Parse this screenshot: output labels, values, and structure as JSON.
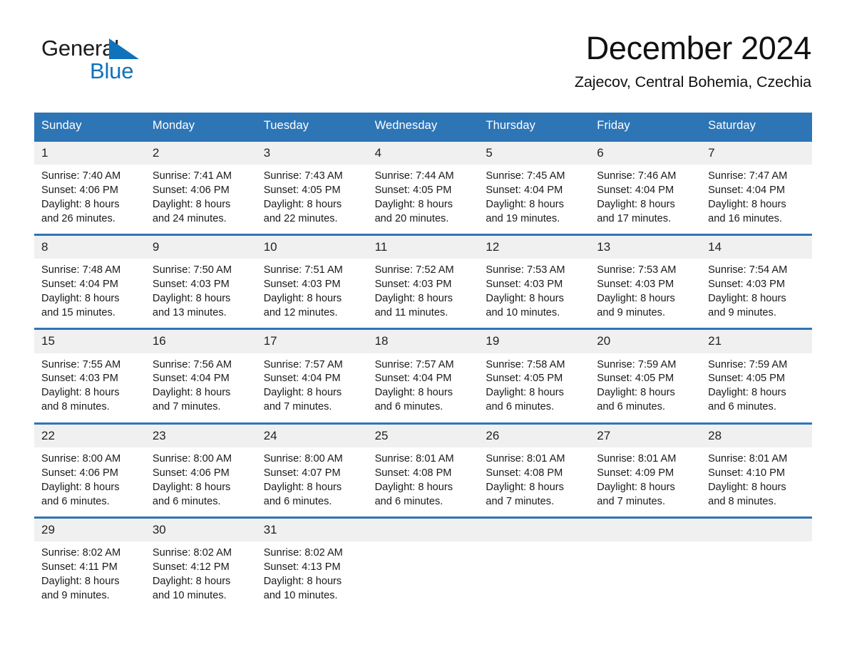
{
  "brand": {
    "name_part1": "General",
    "name_part2": "Blue",
    "accent_color": "#1072bb"
  },
  "header": {
    "title": "December 2024",
    "subtitle": "Zajecov, Central Bohemia, Czechia"
  },
  "theme": {
    "header_blue": "#2e75b6",
    "daynum_band": "#f0f0f0",
    "text": "#1a1a1a"
  },
  "weekdays": [
    "Sunday",
    "Monday",
    "Tuesday",
    "Wednesday",
    "Thursday",
    "Friday",
    "Saturday"
  ],
  "weeks": [
    {
      "days": [
        {
          "num": "1",
          "sunrise": "Sunrise: 7:40 AM",
          "sunset": "Sunset: 4:06 PM",
          "daylight1": "Daylight: 8 hours",
          "daylight2": "and 26 minutes."
        },
        {
          "num": "2",
          "sunrise": "Sunrise: 7:41 AM",
          "sunset": "Sunset: 4:06 PM",
          "daylight1": "Daylight: 8 hours",
          "daylight2": "and 24 minutes."
        },
        {
          "num": "3",
          "sunrise": "Sunrise: 7:43 AM",
          "sunset": "Sunset: 4:05 PM",
          "daylight1": "Daylight: 8 hours",
          "daylight2": "and 22 minutes."
        },
        {
          "num": "4",
          "sunrise": "Sunrise: 7:44 AM",
          "sunset": "Sunset: 4:05 PM",
          "daylight1": "Daylight: 8 hours",
          "daylight2": "and 20 minutes."
        },
        {
          "num": "5",
          "sunrise": "Sunrise: 7:45 AM",
          "sunset": "Sunset: 4:04 PM",
          "daylight1": "Daylight: 8 hours",
          "daylight2": "and 19 minutes."
        },
        {
          "num": "6",
          "sunrise": "Sunrise: 7:46 AM",
          "sunset": "Sunset: 4:04 PM",
          "daylight1": "Daylight: 8 hours",
          "daylight2": "and 17 minutes."
        },
        {
          "num": "7",
          "sunrise": "Sunrise: 7:47 AM",
          "sunset": "Sunset: 4:04 PM",
          "daylight1": "Daylight: 8 hours",
          "daylight2": "and 16 minutes."
        }
      ]
    },
    {
      "days": [
        {
          "num": "8",
          "sunrise": "Sunrise: 7:48 AM",
          "sunset": "Sunset: 4:04 PM",
          "daylight1": "Daylight: 8 hours",
          "daylight2": "and 15 minutes."
        },
        {
          "num": "9",
          "sunrise": "Sunrise: 7:50 AM",
          "sunset": "Sunset: 4:03 PM",
          "daylight1": "Daylight: 8 hours",
          "daylight2": "and 13 minutes."
        },
        {
          "num": "10",
          "sunrise": "Sunrise: 7:51 AM",
          "sunset": "Sunset: 4:03 PM",
          "daylight1": "Daylight: 8 hours",
          "daylight2": "and 12 minutes."
        },
        {
          "num": "11",
          "sunrise": "Sunrise: 7:52 AM",
          "sunset": "Sunset: 4:03 PM",
          "daylight1": "Daylight: 8 hours",
          "daylight2": "and 11 minutes."
        },
        {
          "num": "12",
          "sunrise": "Sunrise: 7:53 AM",
          "sunset": "Sunset: 4:03 PM",
          "daylight1": "Daylight: 8 hours",
          "daylight2": "and 10 minutes."
        },
        {
          "num": "13",
          "sunrise": "Sunrise: 7:53 AM",
          "sunset": "Sunset: 4:03 PM",
          "daylight1": "Daylight: 8 hours",
          "daylight2": "and 9 minutes."
        },
        {
          "num": "14",
          "sunrise": "Sunrise: 7:54 AM",
          "sunset": "Sunset: 4:03 PM",
          "daylight1": "Daylight: 8 hours",
          "daylight2": "and 9 minutes."
        }
      ]
    },
    {
      "days": [
        {
          "num": "15",
          "sunrise": "Sunrise: 7:55 AM",
          "sunset": "Sunset: 4:03 PM",
          "daylight1": "Daylight: 8 hours",
          "daylight2": "and 8 minutes."
        },
        {
          "num": "16",
          "sunrise": "Sunrise: 7:56 AM",
          "sunset": "Sunset: 4:04 PM",
          "daylight1": "Daylight: 8 hours",
          "daylight2": "and 7 minutes."
        },
        {
          "num": "17",
          "sunrise": "Sunrise: 7:57 AM",
          "sunset": "Sunset: 4:04 PM",
          "daylight1": "Daylight: 8 hours",
          "daylight2": "and 7 minutes."
        },
        {
          "num": "18",
          "sunrise": "Sunrise: 7:57 AM",
          "sunset": "Sunset: 4:04 PM",
          "daylight1": "Daylight: 8 hours",
          "daylight2": "and 6 minutes."
        },
        {
          "num": "19",
          "sunrise": "Sunrise: 7:58 AM",
          "sunset": "Sunset: 4:05 PM",
          "daylight1": "Daylight: 8 hours",
          "daylight2": "and 6 minutes."
        },
        {
          "num": "20",
          "sunrise": "Sunrise: 7:59 AM",
          "sunset": "Sunset: 4:05 PM",
          "daylight1": "Daylight: 8 hours",
          "daylight2": "and 6 minutes."
        },
        {
          "num": "21",
          "sunrise": "Sunrise: 7:59 AM",
          "sunset": "Sunset: 4:05 PM",
          "daylight1": "Daylight: 8 hours",
          "daylight2": "and 6 minutes."
        }
      ]
    },
    {
      "days": [
        {
          "num": "22",
          "sunrise": "Sunrise: 8:00 AM",
          "sunset": "Sunset: 4:06 PM",
          "daylight1": "Daylight: 8 hours",
          "daylight2": "and 6 minutes."
        },
        {
          "num": "23",
          "sunrise": "Sunrise: 8:00 AM",
          "sunset": "Sunset: 4:06 PM",
          "daylight1": "Daylight: 8 hours",
          "daylight2": "and 6 minutes."
        },
        {
          "num": "24",
          "sunrise": "Sunrise: 8:00 AM",
          "sunset": "Sunset: 4:07 PM",
          "daylight1": "Daylight: 8 hours",
          "daylight2": "and 6 minutes."
        },
        {
          "num": "25",
          "sunrise": "Sunrise: 8:01 AM",
          "sunset": "Sunset: 4:08 PM",
          "daylight1": "Daylight: 8 hours",
          "daylight2": "and 6 minutes."
        },
        {
          "num": "26",
          "sunrise": "Sunrise: 8:01 AM",
          "sunset": "Sunset: 4:08 PM",
          "daylight1": "Daylight: 8 hours",
          "daylight2": "and 7 minutes."
        },
        {
          "num": "27",
          "sunrise": "Sunrise: 8:01 AM",
          "sunset": "Sunset: 4:09 PM",
          "daylight1": "Daylight: 8 hours",
          "daylight2": "and 7 minutes."
        },
        {
          "num": "28",
          "sunrise": "Sunrise: 8:01 AM",
          "sunset": "Sunset: 4:10 PM",
          "daylight1": "Daylight: 8 hours",
          "daylight2": "and 8 minutes."
        }
      ]
    },
    {
      "days": [
        {
          "num": "29",
          "sunrise": "Sunrise: 8:02 AM",
          "sunset": "Sunset: 4:11 PM",
          "daylight1": "Daylight: 8 hours",
          "daylight2": "and 9 minutes."
        },
        {
          "num": "30",
          "sunrise": "Sunrise: 8:02 AM",
          "sunset": "Sunset: 4:12 PM",
          "daylight1": "Daylight: 8 hours",
          "daylight2": "and 10 minutes."
        },
        {
          "num": "31",
          "sunrise": "Sunrise: 8:02 AM",
          "sunset": "Sunset: 4:13 PM",
          "daylight1": "Daylight: 8 hours",
          "daylight2": "and 10 minutes."
        },
        {
          "num": "",
          "sunrise": "",
          "sunset": "",
          "daylight1": "",
          "daylight2": ""
        },
        {
          "num": "",
          "sunrise": "",
          "sunset": "",
          "daylight1": "",
          "daylight2": ""
        },
        {
          "num": "",
          "sunrise": "",
          "sunset": "",
          "daylight1": "",
          "daylight2": ""
        },
        {
          "num": "",
          "sunrise": "",
          "sunset": "",
          "daylight1": "",
          "daylight2": ""
        }
      ]
    }
  ]
}
